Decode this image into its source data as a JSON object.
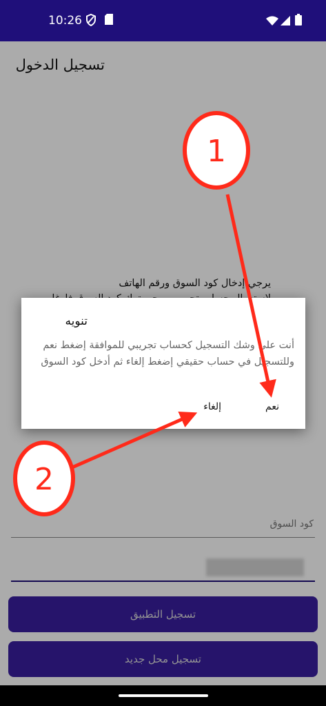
{
  "status_bar": {
    "time": "10:26",
    "icons": [
      "shield-icon",
      "sd-card-icon",
      "wifi-icon",
      "signal-icon",
      "battery-icon"
    ]
  },
  "page": {
    "title": "تسجيل الدخول",
    "instructions_line1": "يرجي إدخال كود السوق ورقم الهاتف",
    "instructions_line2": "لاستعمال حساب تجريبي يرجى ترك كود السوق فارغا"
  },
  "form": {
    "market_code": {
      "value": "",
      "placeholder": "كود السوق"
    },
    "phone": {
      "value": ""
    },
    "register_app_button": "تسجيل التطبيق",
    "register_new_store_button": "تسجيل محل جديد"
  },
  "dialog": {
    "title": "تنويه",
    "message": "أنت علي وشك التسجيل كحساب تجريبي للموافقة إضغط نعم وللتسجيل في حساب حقيقي إضغط إلغاء ثم أدخل كود السوق",
    "confirm_label": "نعم",
    "cancel_label": "إلغاء"
  },
  "annotations": {
    "marker_1": "1",
    "marker_2": "2",
    "color": "#ff2a1a"
  },
  "colors": {
    "primary": "#1f0f7a",
    "button": "#3a1fa0"
  }
}
